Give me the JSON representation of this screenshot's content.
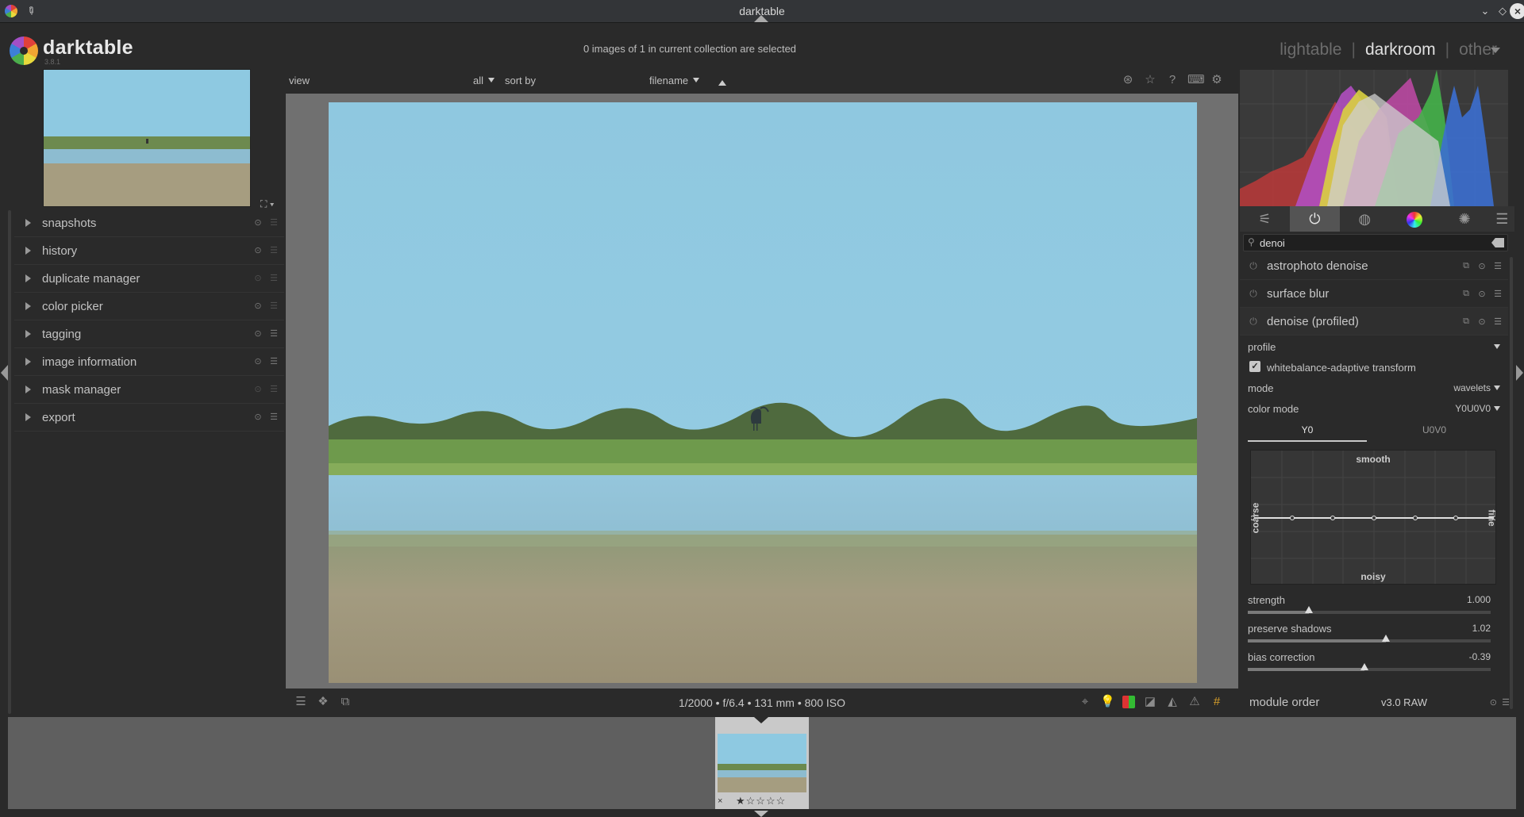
{
  "window": {
    "title": "darktable"
  },
  "header": {
    "app_name": "darktable",
    "version": "3.8.1",
    "selection_status": "0 images of 1 in current collection are selected",
    "views": [
      {
        "label": "lightable",
        "active": false
      },
      {
        "label": "darkroom",
        "active": true
      },
      {
        "label": "other",
        "active": false
      }
    ],
    "separator": "|"
  },
  "left_panel": {
    "modules": [
      {
        "label": "snapshots"
      },
      {
        "label": "history"
      },
      {
        "label": "duplicate manager"
      },
      {
        "label": "color picker"
      },
      {
        "label": "tagging"
      },
      {
        "label": "image information"
      },
      {
        "label": "mask manager"
      },
      {
        "label": "export"
      }
    ]
  },
  "center": {
    "top_toolbar": {
      "view_label": "view",
      "view_value": "all",
      "sort_label": "sort by",
      "sort_value": "filename"
    },
    "exif": "1/2000 • f/6.4 • 131 mm • 800 ISO"
  },
  "right_panel": {
    "search_value": "denoi",
    "modules": [
      {
        "label": "astrophoto denoise"
      },
      {
        "label": "surface blur"
      },
      {
        "label": "denoise (profiled)"
      }
    ],
    "denoise": {
      "profile_label": "profile",
      "profile_value": "",
      "wb_transform_label": "whitebalance-adaptive transform",
      "wb_transform_checked": true,
      "mode_label": "mode",
      "mode_value": "wavelets",
      "color_mode_label": "color mode",
      "color_mode_value": "Y0U0V0",
      "tabs": [
        {
          "label": "Y0",
          "active": true
        },
        {
          "label": "U0V0",
          "active": false
        }
      ],
      "curve_labels": {
        "top": "smooth",
        "bottom": "noisy",
        "left": "coarse",
        "right": "fine"
      },
      "sliders": [
        {
          "label": "strength",
          "value": "1.000",
          "fraction": 0.25
        },
        {
          "label": "preserve shadows",
          "value": "1.02",
          "fraction": 0.57
        },
        {
          "label": "bias correction",
          "value": "-0.39",
          "fraction": 0.48
        }
      ]
    },
    "module_order_label": "module order",
    "module_order_value": "v3.0 RAW"
  },
  "filmstrip": {
    "reject": "×",
    "stars": "★☆☆☆☆"
  },
  "colors": {
    "accent": "#e0e0e0",
    "panel": "#2a2a2a",
    "canvas": "#707070",
    "filmstrip": "#5f5f5f"
  }
}
